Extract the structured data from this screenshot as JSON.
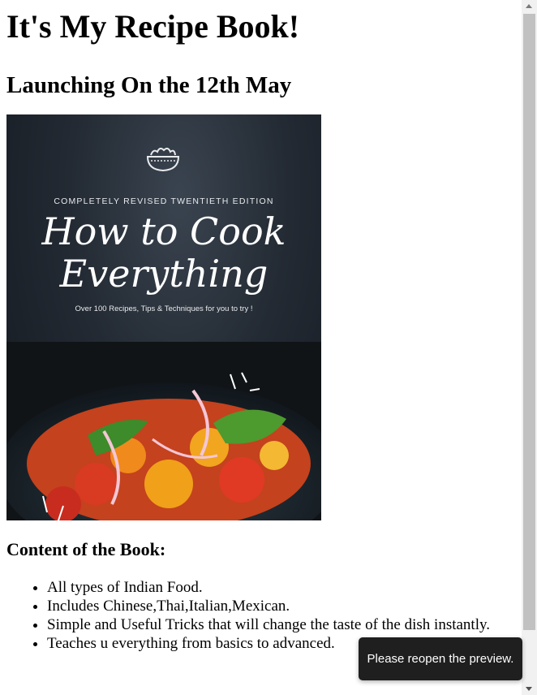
{
  "page": {
    "heading": "It's My Recipe Book!",
    "subheading": "Launching On the 12th May"
  },
  "cover": {
    "edition": "COMPLETELY REVISED TWENTIETH EDITION",
    "title_line1": "How to Cook",
    "title_line2": "Everything",
    "tagline": "Over 100 Recipes, Tips & Techniques for you to try !",
    "icon": "salad-bowl-icon"
  },
  "contents": {
    "heading": "Content of the Book:",
    "items": [
      "All types of Indian Food.",
      "Includes Chinese,Thai,Italian,Mexican.",
      "Simple and Useful Tricks that will change the taste of the dish instantly.",
      "Teaches u everything from basics to advanced."
    ]
  },
  "toast": {
    "message": "Please reopen the preview."
  },
  "colors": {
    "cover_background": "#1c222a",
    "toast_background": "#1f1f1f",
    "scrollbar_thumb": "#c1c1c1"
  }
}
